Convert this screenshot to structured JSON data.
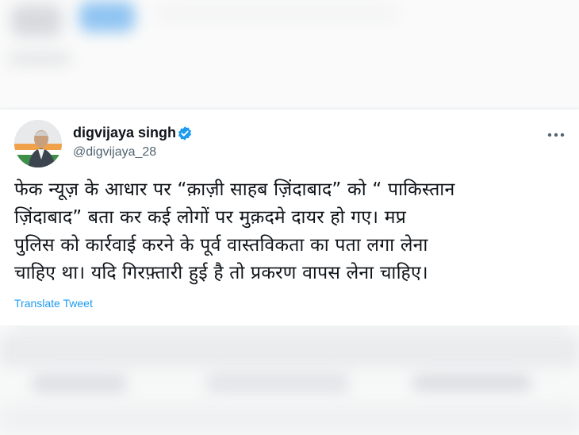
{
  "tweet": {
    "display_name": "digvijaya singh",
    "handle": "@digvijaya_28",
    "text_lines": [
      "फेक न्यूज़ के आधार पर “क़ाज़ी साहब ज़िंदाबाद” को “ पाकिस्तान",
      "ज़िंदाबाद” बता कर कई लोगों पर मुक़दमे दायर हो गए। मप्र",
      "पुलिस को कार्रवाई करने के पूर्व वास्तविकता का पता लगा लेना",
      "चाहिए था। यदि गिरफ़्तारी हुई है तो प्रकरण वापस लेना चाहिए।"
    ],
    "translate_label": "Translate Tweet",
    "icons": {
      "verified": "verified-badge-icon",
      "more": "more-options-icon"
    }
  },
  "colors": {
    "accent": "#1d9bf0",
    "text_primary": "#0f1419",
    "text_secondary": "#536471"
  }
}
